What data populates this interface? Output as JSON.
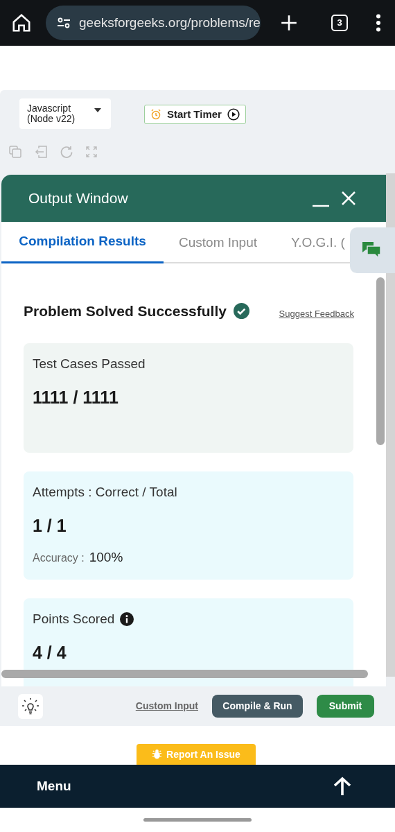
{
  "browser": {
    "url": "geeksforgeeks.org/problems/re",
    "tab_count": "3"
  },
  "editor_toolbar": {
    "language": "Javascript (Node v22)",
    "timer_button": "Start Timer"
  },
  "output_window": {
    "title": "Output Window",
    "tabs": [
      {
        "label": "Compilation Results",
        "selected": true
      },
      {
        "label": "Custom Input",
        "selected": false
      },
      {
        "label": "Y.O.G.I. (",
        "selected": false
      }
    ],
    "status": "Problem Solved Successfully",
    "feedback_link": "Suggest Feedback",
    "cards": [
      {
        "kind": "plain",
        "label": "Test Cases Passed",
        "value": "1111 / 1111"
      },
      {
        "kind": "accuracy",
        "label": "Attempts : Correct / Total",
        "value": "1 / 1",
        "sub_label": "Accuracy :",
        "sub_value": "100%"
      },
      {
        "kind": "info",
        "label": "Points Scored",
        "value": "4 / 4"
      }
    ]
  },
  "action_bar": {
    "custom_input_link": "Custom Input",
    "compile_button": "Compile & Run",
    "submit_button": "Submit"
  },
  "report_button": "Report An Issue",
  "footer": {
    "menu": "Menu"
  }
}
